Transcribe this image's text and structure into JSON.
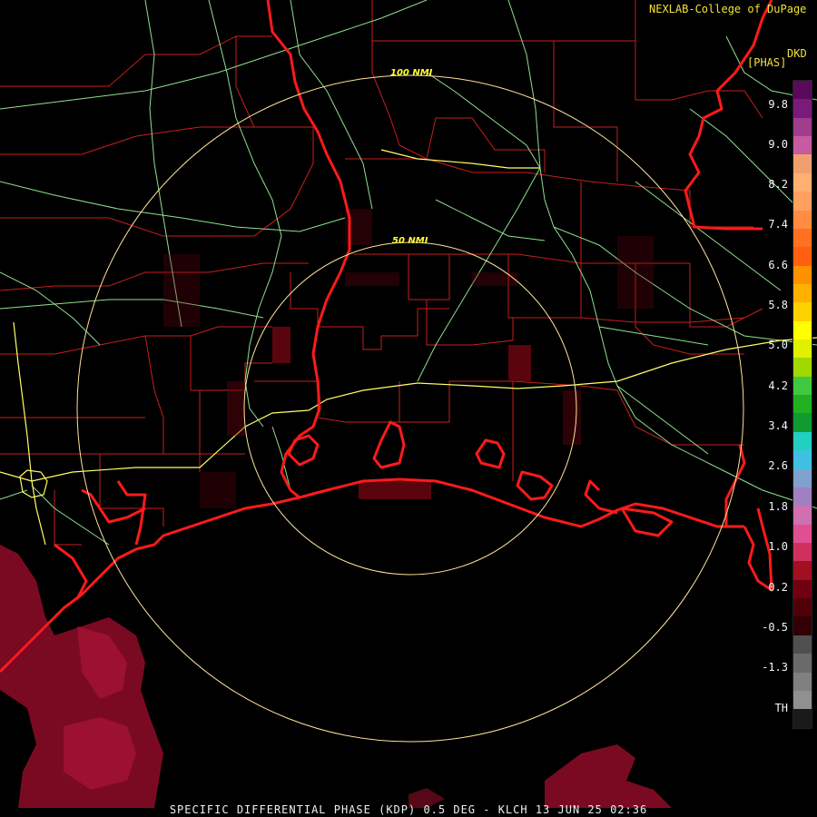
{
  "credit": "NEXLAB-College of DuPage",
  "product_code": "DKD",
  "units": "[PHAS]",
  "caption": "SPECIFIC DIFFERENTIAL PHASE (KDP) 0.5 DEG - KLCH 13 JUN 25 02:36",
  "range_rings": [
    "50 NMI",
    "100 NMI"
  ],
  "colorbar": {
    "ticks": [
      "9.8",
      "9.0",
      "8.2",
      "7.4",
      "6.6",
      "5.8",
      "5.0",
      "4.2",
      "3.4",
      "2.6",
      "1.8",
      "1.0",
      "0.2",
      "-0.5",
      "-1.3",
      "TH"
    ],
    "colors": [
      "#5a0a5a",
      "#7a1a7a",
      "#a03c8c",
      "#c85aa0",
      "#f0a070",
      "#ffb070",
      "#ffa060",
      "#ff8c40",
      "#ff7020",
      "#ff6010",
      "#ff9000",
      "#ffb000",
      "#ffd000",
      "#ffff00",
      "#e0f000",
      "#a0d800",
      "#40c840",
      "#20b020",
      "#109a30",
      "#20d0c0",
      "#40c0e0",
      "#80a0d0",
      "#a080c0",
      "#d070b0",
      "#e05090",
      "#d03060",
      "#a01020",
      "#700010",
      "#500008",
      "#300004",
      "#505050",
      "#6a6a6a",
      "#808080",
      "#909090",
      "#1a1a1a"
    ]
  },
  "colors": {
    "coastline": "#ff1a1a",
    "county": "#c81e1e",
    "highway": "#8fe08f",
    "interstate": "#ffff66",
    "ring": "#ffe39a",
    "echo": "#8b0a1a"
  }
}
